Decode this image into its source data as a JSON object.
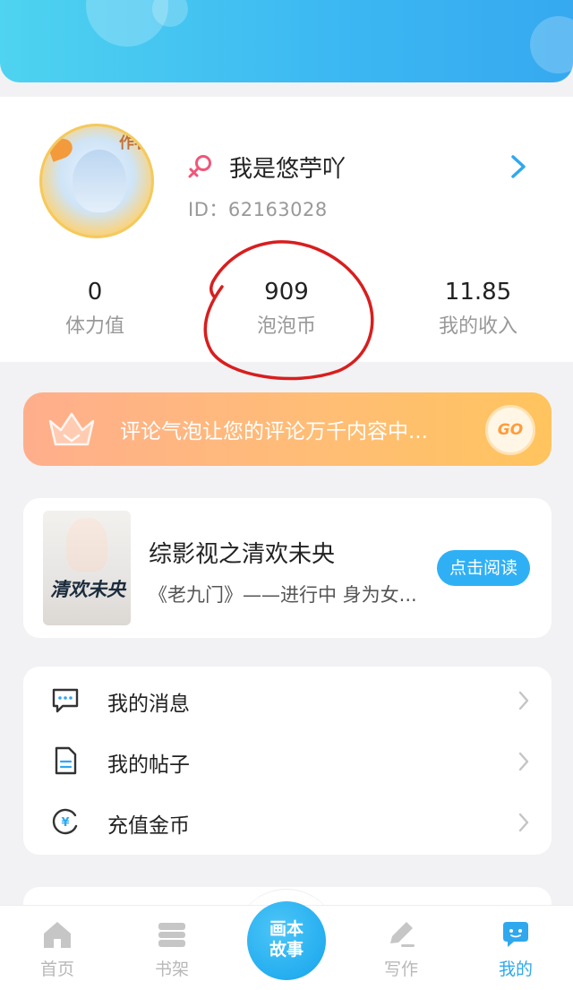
{
  "profile": {
    "nickname": "我是悠苧吖",
    "id_text": "ID：62163028",
    "avatar_badge": "作者"
  },
  "stats": [
    {
      "value": "0",
      "label": "体力值"
    },
    {
      "value": "909",
      "label": "泡泡币"
    },
    {
      "value": "11.85",
      "label": "我的收入"
    }
  ],
  "promo": {
    "text": "评论气泡让您的评论万千内容中...",
    "go_label": "GO"
  },
  "book": {
    "title": "综影视之清欢未央",
    "description": "《老九门》——进行中 身为女...",
    "cover_title": "清欢未央",
    "read_label": "点击阅读"
  },
  "menu": [
    {
      "label": "我的消息",
      "icon": "message-icon"
    },
    {
      "label": "我的帖子",
      "icon": "document-icon"
    },
    {
      "label": "充值金币",
      "icon": "yuan-coin-icon"
    }
  ],
  "bottom_nav": {
    "items": [
      {
        "label": "首页",
        "icon": "home-icon",
        "active": false
      },
      {
        "label": "书架",
        "icon": "bookshelf-icon",
        "active": false
      },
      {
        "label": "写作",
        "icon": "pen-icon",
        "active": false
      },
      {
        "label": "我的",
        "icon": "profile-bubble-icon",
        "active": true
      }
    ],
    "center_line1": "画本",
    "center_line2": "故事"
  },
  "colors": {
    "accent": "#2fa8ee",
    "header_gradient_start": "#4ed3f0",
    "promo_gradient_start": "#ffae8c",
    "annotation_circle": "#d81e1e",
    "inactive_nav": "#b8b8b8"
  }
}
